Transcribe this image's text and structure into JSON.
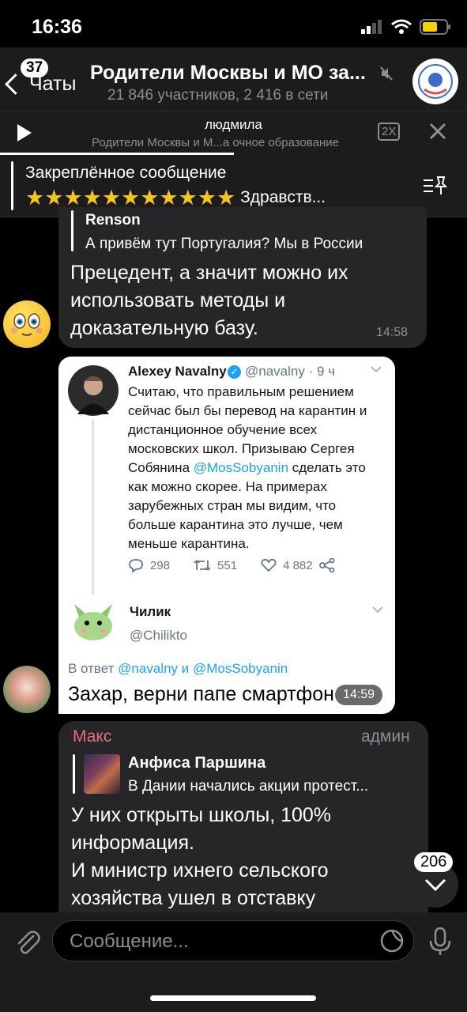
{
  "status": {
    "time": "16:36"
  },
  "header": {
    "back_label": "Чаты",
    "unread": "37",
    "title": "Родители Москвы и МО за...",
    "subtitle": "21 846 участников, 2 416 в сети"
  },
  "player": {
    "name": "людмила",
    "subtitle": "Родители Москвы и М...а очное образование",
    "speed": "2X",
    "progress": 0.5
  },
  "pinned": {
    "title": "Закреплённое сообщение",
    "stars": "★★★★★★★★★★★",
    "text": "Здравств..."
  },
  "messages": {
    "m1": {
      "reply_name": "Renson",
      "reply_text": "А привём тут Португалия? Мы в России",
      "text": "Прецедент, а значит можно их использовать методы и доказательную базу.",
      "time": "14:58"
    },
    "m2": {
      "tweet": {
        "name": "Alexey Navalny",
        "handle": "@navalny · 9 ч",
        "text_part1": "Считаю, что правильным решением сейчас был бы перевод на карантин и дистанционное обучение всех московских школ. Призываю Сергея Собянина ",
        "mention": "@MosSobyanin",
        "text_part2": " сделать это как можно скорее. На примерах зарубежных стран мы видим, что больше карантина это лучше, чем меньше карантина.",
        "replies": "298",
        "retweets": "551",
        "likes": "4 882"
      },
      "reply": {
        "name": "Чилик",
        "handle": "@Chilikto",
        "reply_to_prefix": "В ответ ",
        "reply_to_1": "@navalny",
        "reply_to_and": " и ",
        "reply_to_2": "@MosSobyanin"
      },
      "text": "Захар, верни папе смартфон",
      "time": "14:59"
    },
    "m3": {
      "sender": "Макс",
      "role": "админ",
      "reply_name": "Анфиса Паршина",
      "reply_text": "В Дании начались акции протест...",
      "text_line1": "У них открыты школы, 100%",
      "text_line2": "информация.",
      "text_line3": "И министр ихнего сельского",
      "text_line4": "хозяйства ушел в отставку"
    }
  },
  "scroll_badge": "206",
  "input": {
    "placeholder": "Сообщение..."
  }
}
